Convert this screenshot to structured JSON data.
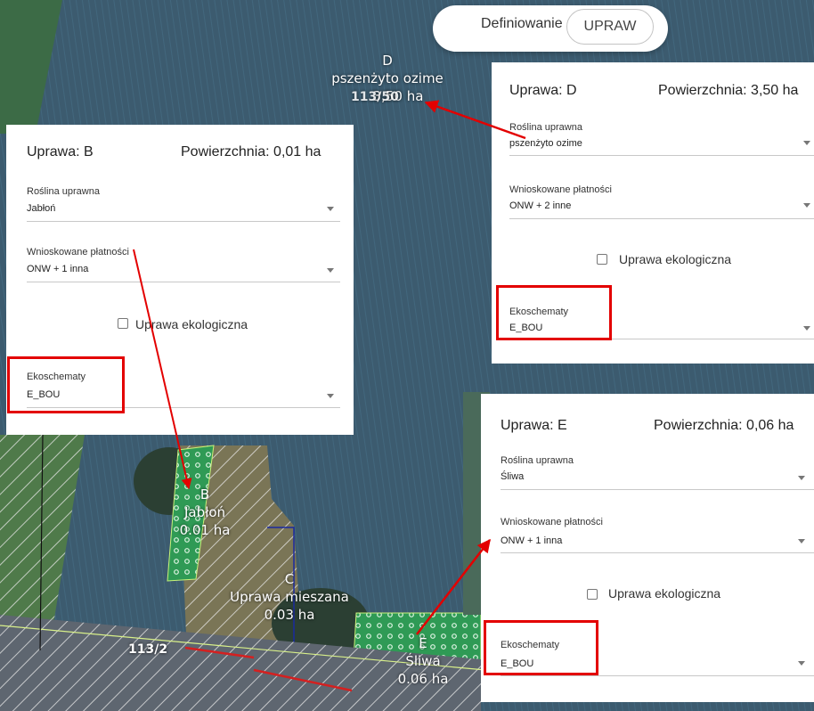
{
  "header": {
    "label": "Definiowanie",
    "button": "UPRAW"
  },
  "map": {
    "parcel_numbers": [
      "113/50",
      "113/2"
    ],
    "crops": [
      {
        "letter": "D",
        "name": "pszenżyto ozime",
        "area": "3,50 ha"
      },
      {
        "letter": "B",
        "name": "Jabłoń",
        "area": "0.01 ha"
      },
      {
        "letter": "C",
        "name": "Uprawa mieszana",
        "area": "0.03 ha"
      },
      {
        "letter": "E",
        "name": "Śliwa",
        "area": "0.06 ha"
      }
    ]
  },
  "panels": [
    {
      "title": "Uprawa: B",
      "area": "Powierzchnia: 0,01 ha",
      "crop_label": "Roślina uprawna",
      "crop_value": "Jabłoń",
      "payments_label": "Wnioskowane płatności",
      "payments_value": "ONW + 1 inna",
      "eco_label": "Uprawa ekologiczna",
      "schemes_label": "Ekoschematy",
      "schemes_value": "E_BOU"
    },
    {
      "title": "Uprawa: D",
      "area": "Powierzchnia: 3,50 ha",
      "crop_label": "Roślina uprawna",
      "crop_value": "pszenżyto ozime",
      "payments_label": "Wnioskowane płatności",
      "payments_value": "ONW + 2 inne",
      "eco_label": "Uprawa ekologiczna",
      "schemes_label": "Ekoschematy",
      "schemes_value": "E_BOU"
    },
    {
      "title": "Uprawa: E",
      "area": "Powierzchnia: 0,06 ha",
      "crop_label": "Roślina uprawna",
      "crop_value": "Śliwa",
      "payments_label": "Wnioskowane płatności",
      "payments_value": "ONW + 1 inna",
      "eco_label": "Uprawa ekologiczna",
      "schemes_label": "Ekoschematy",
      "schemes_value": "E_BOU"
    }
  ],
  "colors": {
    "highlight": "#e30000",
    "parcel_green": "#3aa35a",
    "field_blue": "#3a5a70"
  }
}
